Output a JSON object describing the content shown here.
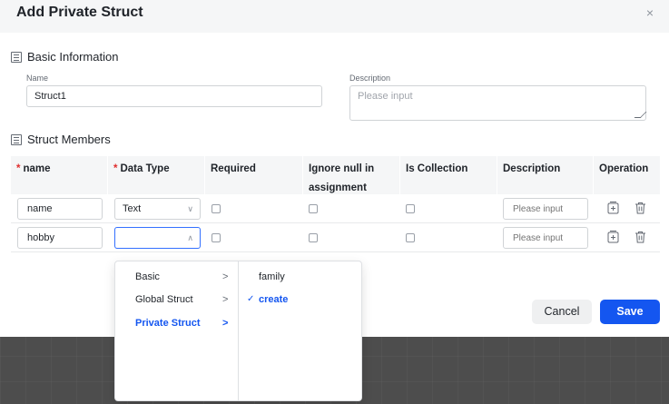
{
  "dialog": {
    "title": "Add Private Struct",
    "close_glyph": "×"
  },
  "basic": {
    "heading": "Basic Information",
    "name_label": "Name",
    "name_value": "Struct1",
    "description_label": "Description",
    "description_placeholder": "Please input"
  },
  "members": {
    "heading": "Struct Members",
    "required_mark": "*",
    "columns": {
      "name": "name",
      "data_type": "Data Type",
      "required": "Required",
      "ignore_null_line1": "Ignore null in",
      "ignore_null_line2": "assignment",
      "is_collection": "Is Collection",
      "description": "Description",
      "operation": "Operation"
    },
    "rows": [
      {
        "name": "name",
        "data_type": "Text",
        "required": false,
        "ignore_null": false,
        "is_collection": false,
        "description_placeholder": "Please input"
      },
      {
        "name": "hobby",
        "data_type": "",
        "required": false,
        "ignore_null": false,
        "is_collection": false,
        "description_placeholder": "Please input"
      }
    ]
  },
  "cascader": {
    "level1": [
      {
        "label": "Basic",
        "selected": false
      },
      {
        "label": "Global Struct",
        "selected": false
      },
      {
        "label": "Private Struct",
        "selected": true
      }
    ],
    "level2": [
      {
        "label": "family",
        "selected": false
      },
      {
        "label": "create",
        "selected": true
      }
    ],
    "check_glyph": "✓",
    "arrow_glyph": ">"
  },
  "footer": {
    "cancel_label": "Cancel",
    "save_label": "Save"
  },
  "colors": {
    "accent": "#1456f0",
    "required": "#e02d2d",
    "header_bg": "#f5f6f7"
  }
}
